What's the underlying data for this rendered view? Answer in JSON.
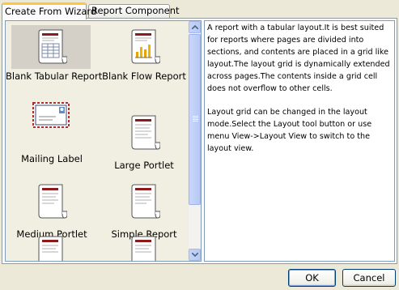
{
  "tabs": [
    {
      "label": "Create From Wizard",
      "active": true
    },
    {
      "label": "Report Component",
      "active": false
    }
  ],
  "gallery": {
    "items": [
      {
        "label": "Blank Tabular Report",
        "icon": "tabular-report-icon",
        "selected": true
      },
      {
        "label": "Blank Flow Report",
        "icon": "flow-report-icon",
        "selected": false
      },
      {
        "label": "Mailing Label",
        "icon": "mailing-label-icon",
        "selected": false
      },
      {
        "label": "Large Portlet",
        "icon": "large-portlet-icon",
        "selected": false
      },
      {
        "label": "Medium Portlet",
        "icon": "medium-portlet-icon",
        "selected": false
      },
      {
        "label": "Simple Report",
        "icon": "simple-report-icon",
        "selected": false
      }
    ]
  },
  "description": {
    "paragraphs": [
      "A report with a tabular layout.It is best suited for reports where pages are divided into sections, and contents are placed in a grid like layout.The layout grid is dynamically extended across pages.The contents inside a grid cell does not overflow to other cells.",
      "Layout grid can be changed in the layout mode.Select the Layout tool button or use menu View->Layout View to switch to the layout view."
    ]
  },
  "buttons": {
    "ok": "OK",
    "cancel": "Cancel"
  },
  "colors": {
    "selection": "#d4d0c8",
    "tab_highlight": "#ffc83c",
    "scrollbar": "#c1d2fb"
  }
}
